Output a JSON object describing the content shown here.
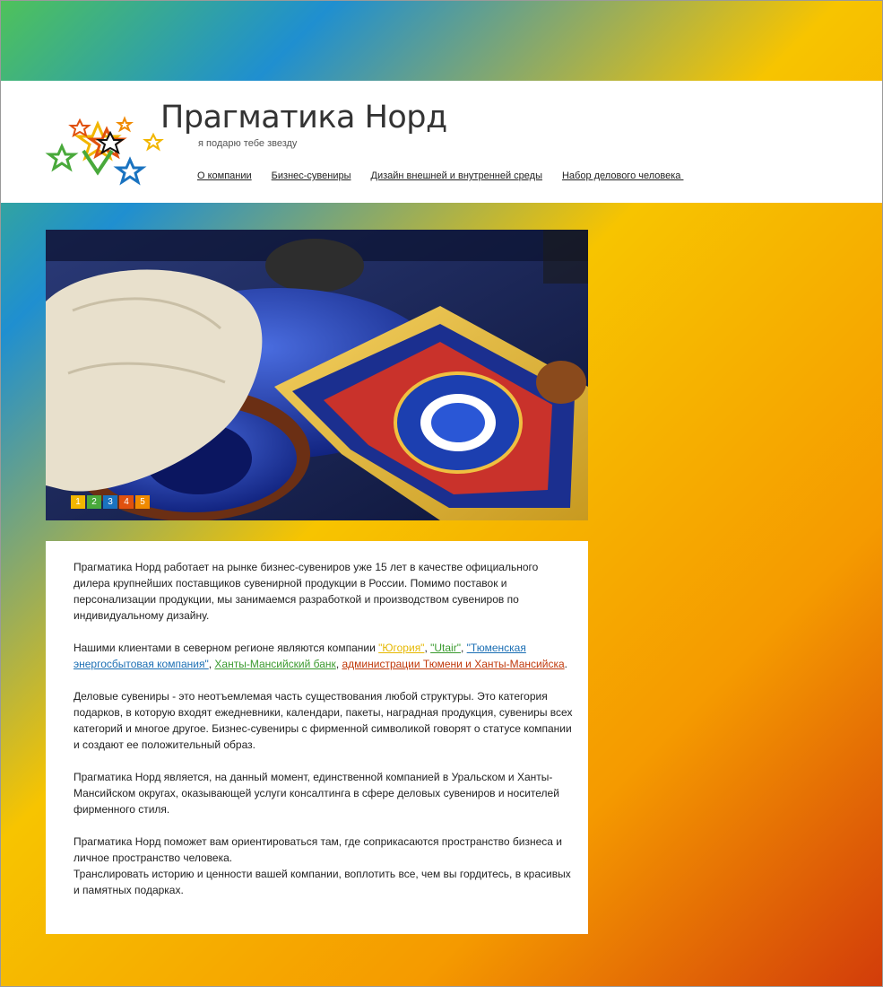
{
  "header": {
    "brand": "Прагматика Норд",
    "tagline": "я подарю тебе звезду",
    "nav": [
      "О компании",
      "Бизнес-сувениры",
      "Дизайн внешней и внутренней среды",
      "Набор делового человека "
    ]
  },
  "slider": {
    "pages": [
      "1",
      "2",
      "3",
      "4",
      "5"
    ],
    "page_colors": [
      "#f2b600",
      "#49a93b",
      "#1a73c0",
      "#e0510e",
      "#f08a00"
    ]
  },
  "content": {
    "p1": "Прагматика Норд работает на рынке бизнес-сувениров уже 15 лет в качестве официального дилера крупнейших поставщиков сувенирной продукции в России. Помимо поставок и персонализации продукции, мы занимаемся разработкой и производством сувениров по индивидуальному дизайну.",
    "p2_intro": "Нашими клиентами в северном регионе являются компании ",
    "client_ugoria": "\"Югория\"",
    "client_utair": "\"Utair\"",
    "client_tek": "\"Тюменская энергосбытовая компания\"",
    "client_khmb": "Ханты-Мансийский банк",
    "client_admin": "администрации Тюмени и Ханты-Мансийска",
    "sep1": ", ",
    "sep2": ", ",
    "sep3": ", ",
    "sep4": ", ",
    "end": ".",
    "p3": "Деловые сувениры - это неотъемлемая часть существования любой структуры. Это категория подарков, в которую входят ежедневники, календари, пакеты, наградная продукция, сувениры всех категорий и многое другое. Бизнес-сувениры с фирменной символикой говорят о статусе компании и создают ее положительный образ.",
    "p4": "Прагматика Норд является, на данный момент, единственной компанией в Уральском и Ханты-Мансийском округах, оказывающей услуги консалтинга в сфере деловых сувениров и носителей фирменного стиля.",
    "p5a": "Прагматика Норд поможет вам ориентироваться там, где соприкасаются пространство бизнеса и личное пространство человека.",
    "p5b": "Транслировать историю и ценности вашей компании, воплотить все, чем вы гордитесь, в красивых и памятных подарках."
  },
  "colors": {
    "ugoria": "#e6b800",
    "utair": "#3a9a2e",
    "tek": "#1c6fb4",
    "khmb": "#3a9a2e",
    "admin": "#c0390b"
  }
}
